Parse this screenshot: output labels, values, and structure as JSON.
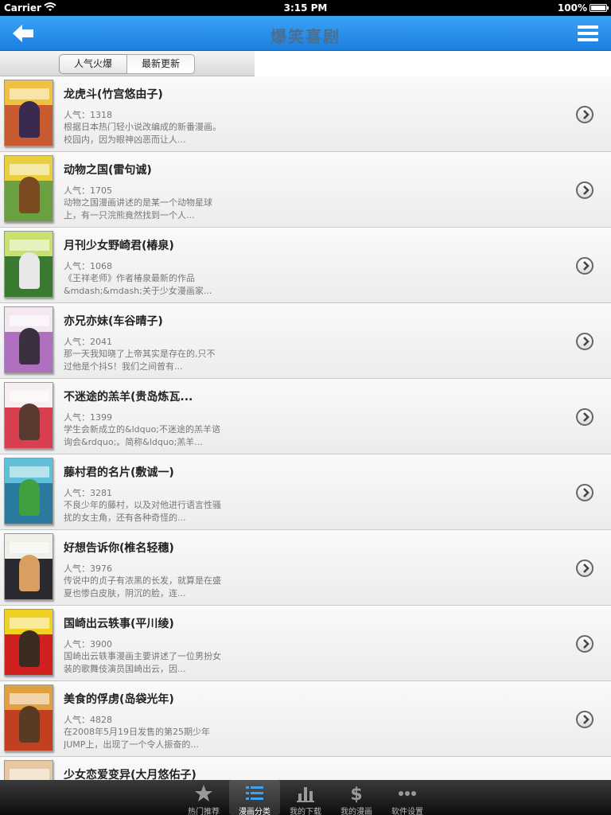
{
  "status": {
    "carrier": "Carrier",
    "time": "3:15 PM",
    "battery": "100%",
    "battery_level": 1.0
  },
  "nav": {
    "title": "爆笑喜剧"
  },
  "segments": [
    "人气火爆",
    "最新更新"
  ],
  "items": [
    {
      "title": "龙虎斗(竹宫悠由子)",
      "pop_label": "人气：",
      "pop": "1318",
      "desc": "根据日本热门轻小说改编成的新番漫画。校园内，因为眼神凶恶而让人..."
    },
    {
      "title": "动物之国(雷句诚)",
      "pop_label": "人气：",
      "pop": "1705",
      "desc": "动物之国漫画讲述的是某一个动物星球上，有一只浣熊竟然找到一个人..."
    },
    {
      "title": "月刊少女野崎君(椿泉)",
      "pop_label": "人气：",
      "pop": "1068",
      "desc": "《王祥老师》作者椿泉最新的作品&mdash;&mdash;关于少女漫画家..."
    },
    {
      "title": "亦兄亦妹(车谷晴子)",
      "pop_label": "人气：",
      "pop": "2041",
      "desc": "那一天我知晓了上帝其实是存在的,只不过他是个抖S！我们之间曾有..."
    },
    {
      "title": "不迷途的羔羊(贵岛炼瓦...",
      "pop_label": "人气：",
      "pop": "1399",
      "desc": "学生会新成立的&ldquo;不迷途的羔羊谘询会&rdquo;。简称&ldquo;羔羊..."
    },
    {
      "title": "藤村君的名片(敷诚一)",
      "pop_label": "人气：",
      "pop": "3281",
      "desc": "不良少年的藤村，以及对他进行语言性骚扰的女主角，还有各种奇怪的..."
    },
    {
      "title": "好想告诉你(椎名轻穗)",
      "pop_label": "人气：",
      "pop": "3976",
      "desc": "传说中的贞子有浓黑的长发，就算是在盛夏也惨白皮肤，阴沉的脸，连..."
    },
    {
      "title": "国崎出云轶事(平川绫)",
      "pop_label": "人气：",
      "pop": "3900",
      "desc": "国崎出云轶事漫画主要讲述了一位男扮女装的歌舞伎演员国崎出云，因..."
    },
    {
      "title": "美食的俘虏(岛袋光年)",
      "pop_label": "人气：",
      "pop": "4828",
      "desc": "在2008年5月19日发售的第25期少年JUMP上，出现了一个令人振奋的..."
    },
    {
      "title": "少女恋爱变异(大月悠佑子)",
      "pop_label": "",
      "pop": "",
      "desc": ""
    }
  ],
  "tabs": [
    {
      "label": "热门推荐",
      "icon": "star-icon"
    },
    {
      "label": "漫画分类",
      "icon": "list-icon",
      "active": true
    },
    {
      "label": "我的下载",
      "icon": "bar-chart-icon"
    },
    {
      "label": "我的漫画",
      "icon": "dollar-icon"
    },
    {
      "label": "软件设置",
      "icon": "more-icon"
    }
  ],
  "colors": {
    "nav_blue": "#2a90ea",
    "tabbar": "#1a1a1a"
  }
}
